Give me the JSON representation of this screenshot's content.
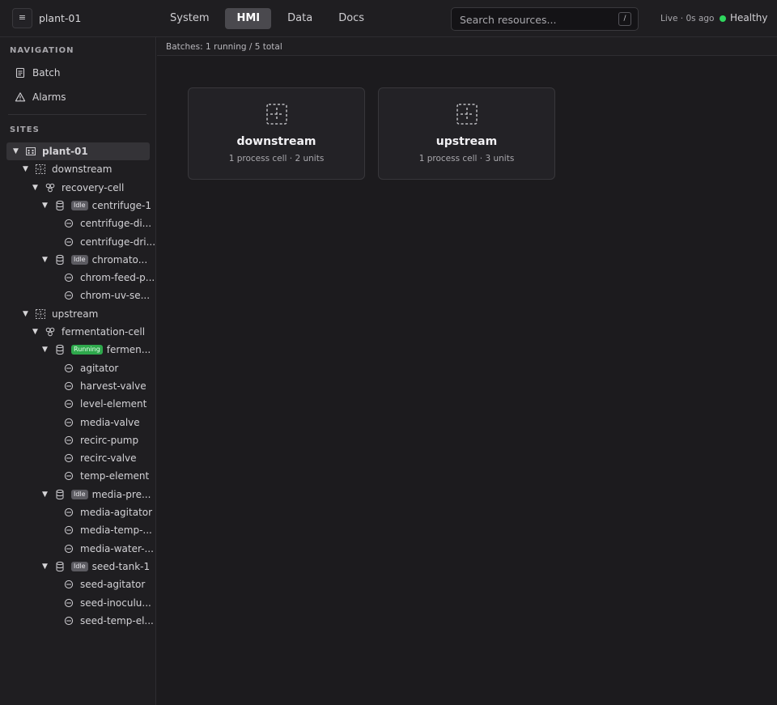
{
  "header": {
    "menu_icon": "hamburger-icon",
    "site": "plant-01",
    "tabs": [
      {
        "label": "System"
      },
      {
        "label": "HMI",
        "active": true
      },
      {
        "label": "Data"
      },
      {
        "label": "Docs"
      }
    ],
    "search_placeholder": "Search resources...",
    "search_shortcut": "/",
    "live_status": "Live · 0s ago",
    "health": "Healthy",
    "health_color": "#2fd75e"
  },
  "sidebar": {
    "navigation_label": "NAVIGATION",
    "nav_items": [
      {
        "label": "Batch",
        "icon": "document-icon"
      },
      {
        "label": "Alarms",
        "icon": "warning-icon"
      }
    ],
    "sites_label": "SITES",
    "tree": [
      {
        "label": "plant-01",
        "type": "site",
        "expanded": true,
        "selected": true
      },
      {
        "label": "downstream",
        "type": "area",
        "expanded": true
      },
      {
        "label": "recovery-cell",
        "type": "cell",
        "expanded": true
      },
      {
        "label": "centrifuge-1",
        "type": "unit",
        "expanded": true,
        "status": "Idle"
      },
      {
        "label": "centrifuge-di...",
        "type": "equipment"
      },
      {
        "label": "centrifuge-dri...",
        "type": "equipment"
      },
      {
        "label": "chromato...",
        "type": "unit",
        "expanded": true,
        "status": "Idle"
      },
      {
        "label": "chrom-feed-p...",
        "type": "equipment"
      },
      {
        "label": "chrom-uv-se...",
        "type": "equipment"
      },
      {
        "label": "upstream",
        "type": "area",
        "expanded": true
      },
      {
        "label": "fermentation-cell",
        "type": "cell",
        "expanded": true
      },
      {
        "label": "fermen...",
        "type": "unit",
        "expanded": true,
        "status": "Running"
      },
      {
        "label": "agitator",
        "type": "equipment"
      },
      {
        "label": "harvest-valve",
        "type": "equipment"
      },
      {
        "label": "level-element",
        "type": "equipment"
      },
      {
        "label": "media-valve",
        "type": "equipment"
      },
      {
        "label": "recirc-pump",
        "type": "equipment"
      },
      {
        "label": "recirc-valve",
        "type": "equipment"
      },
      {
        "label": "temp-element",
        "type": "equipment"
      },
      {
        "label": "media-pre...",
        "type": "unit",
        "expanded": true,
        "status": "Idle"
      },
      {
        "label": "media-agitator",
        "type": "equipment"
      },
      {
        "label": "media-temp-...",
        "type": "equipment"
      },
      {
        "label": "media-water-...",
        "type": "equipment"
      },
      {
        "label": "seed-tank-1",
        "type": "unit",
        "expanded": true,
        "status": "Idle"
      },
      {
        "label": "seed-agitator",
        "type": "equipment"
      },
      {
        "label": "seed-inoculu...",
        "type": "equipment"
      },
      {
        "label": "seed-temp-el...",
        "type": "equipment"
      }
    ]
  },
  "main": {
    "batch_summary": "Batches: 1 running / 5 total",
    "cards": [
      {
        "title": "downstream",
        "subtitle": "1 process cell · 2 units",
        "icon": "area-icon"
      },
      {
        "title": "upstream",
        "subtitle": "1 process cell · 3 units",
        "icon": "area-icon"
      }
    ]
  }
}
